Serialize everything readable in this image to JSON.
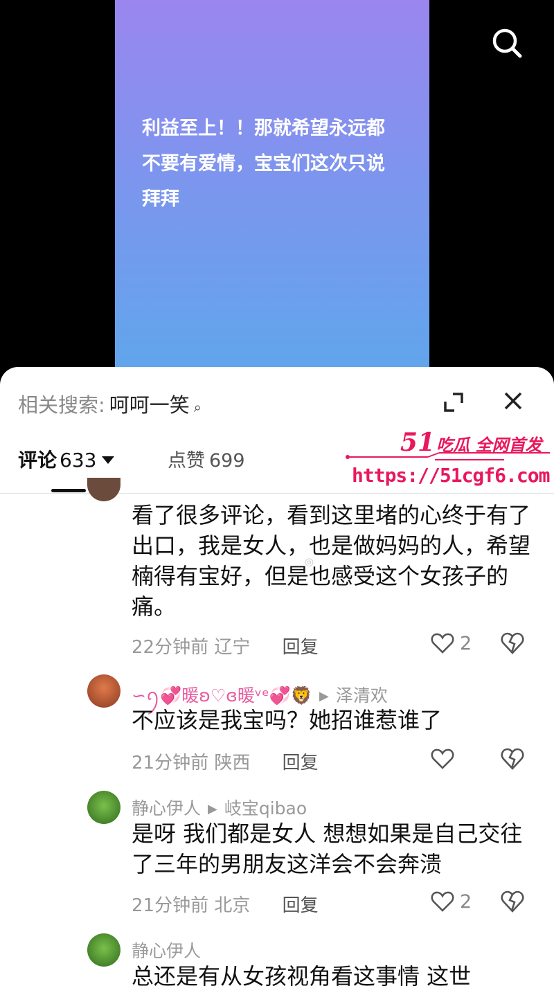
{
  "video": {
    "caption": "利益至上！！那就希望永远都不要有爱情，宝宝们这次只说拜拜"
  },
  "related_search": {
    "label": "相关搜索:",
    "keyword": "呵呵一笑"
  },
  "tabs": {
    "comments_label": "评论",
    "comments_count": "633",
    "likes_label": "点赞",
    "likes_count": "699"
  },
  "watermark": {
    "logo_num": "51",
    "logo_text": "吃瓜 全网首发",
    "url": "https://51cgf6.com"
  },
  "comments": [
    {
      "text": "看了很多评论，看到这里堵的心终于有了出口，我是女人，也是做妈妈的人，希望楠得有宝好，但是也感受这个女孩子的痛。",
      "time": "22分钟前",
      "location": "辽宁",
      "reply": "回复",
      "likes": "2"
    },
    {
      "user": "∽ꪆ⁠💞暖ʚ♡ɞ暖ᵛᵉ💞🦁",
      "reply_to": "泽清欢",
      "text": "不应该是我宝吗？她招谁惹谁了",
      "time": "21分钟前",
      "location": "陕西",
      "reply": "回复",
      "likes": ""
    },
    {
      "user": "静心伊人",
      "reply_to": "岐宝qibao",
      "text": "是呀 我们都是女人 想想如果是自己交往了三年的男朋友这洋会不会奔溃",
      "time": "21分钟前",
      "location": "北京",
      "reply": "回复",
      "likes": "2"
    },
    {
      "user": "静心伊人",
      "text": "总还是有从女孩视角看这事情 这世"
    }
  ],
  "colors": {
    "accent": "#e8185c",
    "card_top": "#9a86ee",
    "card_bottom": "#5ea7ec"
  },
  "icons": [
    "search-icon",
    "expand-icon",
    "close-icon",
    "heart-icon",
    "broken-heart-icon",
    "chevron-down-icon"
  ]
}
